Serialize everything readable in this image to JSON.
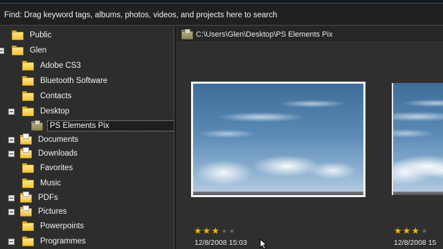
{
  "find_bar": {
    "text": "Find: Drag keyword tags, albums, photos, videos, and projects here to search"
  },
  "path_bar": {
    "path": "C:\\Users\\Glen\\Desktop\\PS Elements Pix"
  },
  "tree": {
    "items": [
      {
        "label": "Public",
        "toggle": "none",
        "icon": "folder-icon"
      },
      {
        "label": "Glen",
        "toggle": "minus",
        "icon": "folder-icon"
      },
      {
        "label": "Adobe CS3",
        "toggle": "none",
        "icon": "folder-icon"
      },
      {
        "label": "Bluetooth Software",
        "toggle": "none",
        "icon": "folder-icon"
      },
      {
        "label": "Contacts",
        "toggle": "none",
        "icon": "folder-icon"
      },
      {
        "label": "Desktop",
        "toggle": "minus",
        "icon": "folder-icon"
      },
      {
        "label": "PS Elements Pix",
        "toggle": "none",
        "icon": "photo-folder-icon",
        "selected": true
      },
      {
        "label": "Documents",
        "toggle": "plus",
        "icon": "special-folder-icon"
      },
      {
        "label": "Downloads",
        "toggle": "plus",
        "icon": "special-folder-icon"
      },
      {
        "label": "Favorites",
        "toggle": "none",
        "icon": "folder-icon"
      },
      {
        "label": "Music",
        "toggle": "none",
        "icon": "folder-icon"
      },
      {
        "label": "PDFs",
        "toggle": "plus",
        "icon": "special-folder-icon"
      },
      {
        "label": "Pictures",
        "toggle": "plus",
        "icon": "special-folder-icon"
      },
      {
        "label": "Powerpoints",
        "toggle": "none",
        "icon": "folder-icon"
      },
      {
        "label": "Programmes",
        "toggle": "plus",
        "icon": "folder-icon"
      }
    ]
  },
  "thumbnails": [
    {
      "rating": 3,
      "max_rating": 5,
      "date": "12/8/2008 15:03"
    },
    {
      "rating": 3,
      "max_rating": 5,
      "date": "12/8/2008 15"
    }
  ],
  "colors": {
    "star_on": "#f0b400",
    "star_off": "#6e6e6e",
    "folder": "#f2c43a"
  }
}
